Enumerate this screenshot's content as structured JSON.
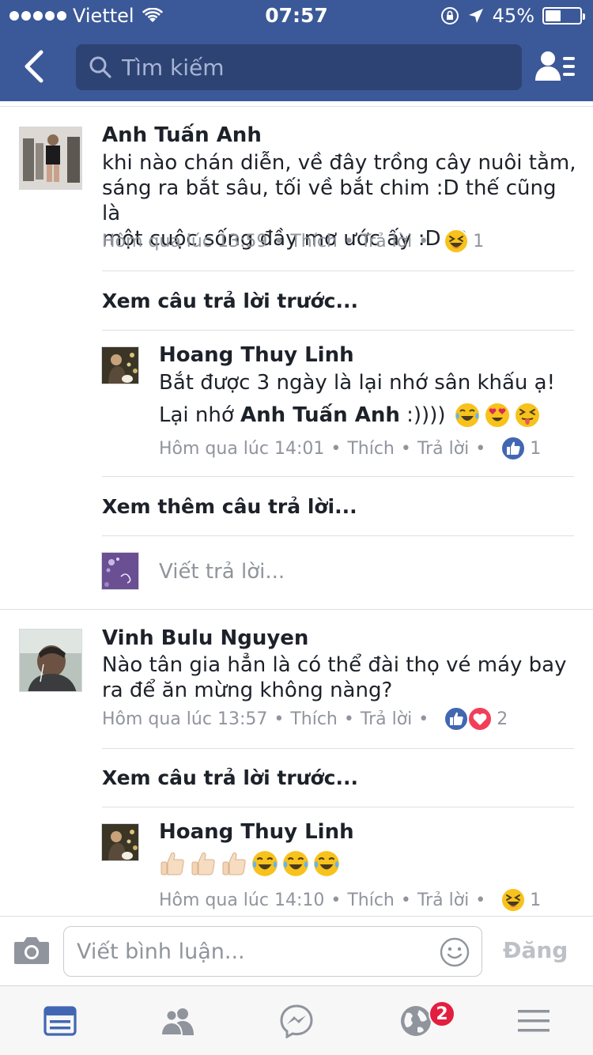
{
  "status_bar": {
    "carrier": "Viettel",
    "time": "07:57",
    "battery": "45%",
    "battery_level": 0.45
  },
  "header": {
    "search_placeholder": "Tìm kiếm"
  },
  "comments": [
    {
      "author": "Anh Tuấn Anh",
      "lines": [
        "khi nào chán diễn, về đây trồng cây nuôi tằm,",
        "sáng ra bắt sâu, tối về bắt chim :D thế cũng là",
        "một cuộc sống đầy mơ ước ấy :D :P"
      ],
      "time": "Hôm qua lúc 13:59",
      "like": "Thích",
      "reply": "Trả lời",
      "reactions": [
        "laugh-squint"
      ],
      "reaction_count": "1",
      "prev_replies": "Xem câu trả lời trước...",
      "reply_item": {
        "author": "Hoang Thuy Linh",
        "line1": "Bắt được 3 ngày là lại nhớ sân khấu ạ!",
        "line2_prefix": "Lại nhớ ",
        "mention": "Anh Tuấn Anh",
        "line2_suffix": " :))))",
        "emojis": [
          "tears-of-joy",
          "heart-eyes",
          "tongue-squint"
        ],
        "time": "Hôm qua lúc 14:01",
        "like": "Thích",
        "reply": "Trả lời",
        "reactions": [
          "like"
        ],
        "reaction_count": "1"
      },
      "more_replies": "Xem thêm câu trả lời...",
      "write_reply_placeholder": "Viết trả lời..."
    },
    {
      "author": "Vinh Bulu Nguyen",
      "lines": [
        "Nào tân gia hẳn là có thể đài thọ vé máy bay",
        "ra để ăn mừng không nàng?"
      ],
      "time": "Hôm qua lúc 13:57",
      "like": "Thích",
      "reply": "Trả lời",
      "reactions": [
        "like",
        "love"
      ],
      "reaction_count": "2",
      "prev_replies": "Xem câu trả lời trước...",
      "reply_item": {
        "author": "Hoang Thuy Linh",
        "emojis": [
          "thumbs-up",
          "thumbs-up",
          "thumbs-up",
          "tears-of-joy",
          "tears-of-joy",
          "tears-of-joy"
        ],
        "time": "Hôm qua lúc 14:10",
        "like": "Thích",
        "reply": "Trả lời",
        "reactions": [
          "laugh-squint"
        ],
        "reaction_count": "1"
      }
    }
  ],
  "composer": {
    "placeholder": "Viết bình luận...",
    "post_label": "Đăng"
  },
  "tabbar": {
    "notifications_badge": "2"
  },
  "colors": {
    "header": "#3b5998",
    "link_blue": "#4267b2",
    "meta_gray": "#90949c",
    "badge_red": "#e41e3f"
  }
}
